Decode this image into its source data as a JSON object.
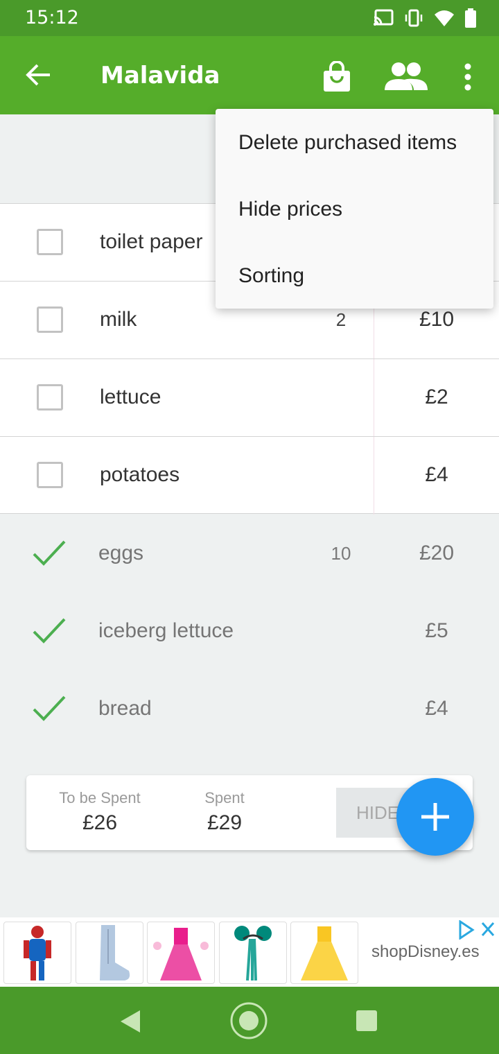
{
  "status_bar": {
    "time": "15:12"
  },
  "app_bar": {
    "title": "Malavida"
  },
  "menu": {
    "items": [
      "Delete purchased items",
      "Hide prices",
      "Sorting"
    ]
  },
  "pending_items": [
    {
      "name": "toilet paper",
      "qty": "",
      "price": ""
    },
    {
      "name": "milk",
      "qty": "2",
      "price": "£10"
    },
    {
      "name": "lettuce",
      "qty": "",
      "price": "£2"
    },
    {
      "name": "potatoes",
      "qty": "",
      "price": "£4"
    }
  ],
  "purchased_items": [
    {
      "name": "eggs",
      "qty": "10",
      "price": "£20"
    },
    {
      "name": "iceberg lettuce",
      "qty": "",
      "price": "£5"
    },
    {
      "name": "bread",
      "qty": "",
      "price": "£4"
    }
  ],
  "summary": {
    "to_be_spent_label": "To be Spent",
    "to_be_spent_value": "£26",
    "spent_label": "Spent",
    "spent_value": "£29",
    "hide_label": "HIDE"
  },
  "ad": {
    "text": "shopDisney.es"
  },
  "colors": {
    "app_bar": "#55ad2a",
    "status_bar": "#4a9a2a",
    "fab": "#2196f3",
    "check": "#4caf50"
  }
}
